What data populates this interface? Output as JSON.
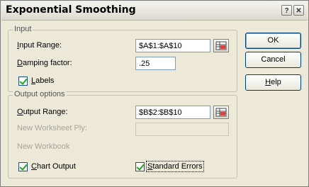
{
  "dialog": {
    "title": "Exponential Smoothing",
    "help_glyph": "?",
    "close_glyph": "✕"
  },
  "input_group": {
    "label": "Input",
    "input_range": {
      "label_ul": "I",
      "label_rest": "nput Range:",
      "value": "$A$1:$A$10"
    },
    "damping": {
      "label_ul": "D",
      "label_rest": "amping factor:",
      "value": ".25"
    },
    "labels_checkbox": {
      "label_ul": "L",
      "label_rest": "abels",
      "checked": true
    }
  },
  "output_group": {
    "label": "Output options",
    "output_range": {
      "label_ul": "O",
      "label_rest": "utput Range:",
      "value": "$B$2:$B$10"
    },
    "new_worksheet": {
      "label": "New Worksheet Ply:",
      "value": ""
    },
    "new_workbook": {
      "label": "New Workbook"
    },
    "chart_output": {
      "label_ul": "C",
      "label_rest": "hart Output",
      "checked": true
    },
    "standard_errors": {
      "label_ul": "S",
      "label_rest": "tandard Errors",
      "checked": true
    }
  },
  "buttons": {
    "ok": "OK",
    "cancel": "Cancel",
    "help_ul": "H",
    "help_rest": "elp"
  }
}
